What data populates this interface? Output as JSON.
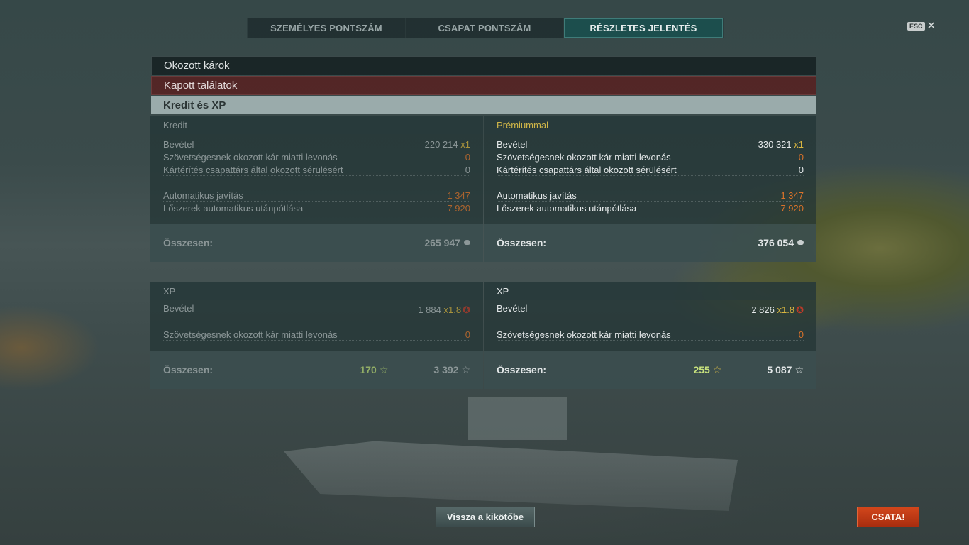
{
  "tabs": [
    "SZEMÉLYES PONTSZÁM",
    "CSAPAT PONTSZÁM",
    "RÉSZLETES JELENTÉS"
  ],
  "esc_label": "ESC",
  "close_glyph": "✕",
  "sections": [
    "Okozott károk",
    "Kapott találatok",
    "Kredit és XP"
  ],
  "credit": {
    "left": {
      "header": "Kredit",
      "rows": [
        {
          "label": "Bevétel",
          "value": "220 214",
          "mult": "x1"
        },
        {
          "label": "Szövetségesnek okozott kár miatti levonás",
          "value": "0"
        },
        {
          "label": "Kártérítés csapattárs által okozott sérülésért",
          "value": "0"
        },
        {
          "label": "Automatikus javítás",
          "value": "1 347"
        },
        {
          "label": "Lőszerek automatikus utánpótlása",
          "value": "7 920"
        }
      ],
      "total_label": "Összesen:",
      "total_value": "265 947"
    },
    "right": {
      "header": "Prémiummal",
      "rows": [
        {
          "label": "Bevétel",
          "value": "330 321",
          "mult": "x1"
        },
        {
          "label": "Szövetségesnek okozott kár miatti levonás",
          "value": "0"
        },
        {
          "label": "Kártérítés csapattárs által okozott sérülésért",
          "value": "0"
        },
        {
          "label": "Automatikus javítás",
          "value": "1 347"
        },
        {
          "label": "Lőszerek automatikus utánpótlása",
          "value": "7 920"
        }
      ],
      "total_label": "Összesen:",
      "total_value": "376 054"
    }
  },
  "xp": {
    "left": {
      "header": "XP",
      "rows": [
        {
          "label": "Bevétel",
          "value": "1 884",
          "mult": "x1.8"
        },
        {
          "label": "Szövetségesnek okozott kár miatti levonás",
          "value": "0"
        }
      ],
      "total_label": "Összesen:",
      "total_free": "170",
      "total_value": "3 392"
    },
    "right": {
      "header": "XP",
      "rows": [
        {
          "label": "Bevétel",
          "value": "2 826",
          "mult": "x1.8"
        },
        {
          "label": "Szövetségesnek okozott kár miatti levonás",
          "value": "0"
        }
      ],
      "total_label": "Összesen:",
      "total_free": "255",
      "total_value": "5 087"
    }
  },
  "star_glyph": "☆",
  "xp_glyph": "✪",
  "buttons": {
    "back": "Vissza a kikötőbe",
    "battle": "CSATA!"
  },
  "icons": {
    "credit": "credit-coin-icon",
    "star": "free-xp-star-icon",
    "xp": "xp-badge-icon",
    "close": "close-icon"
  }
}
